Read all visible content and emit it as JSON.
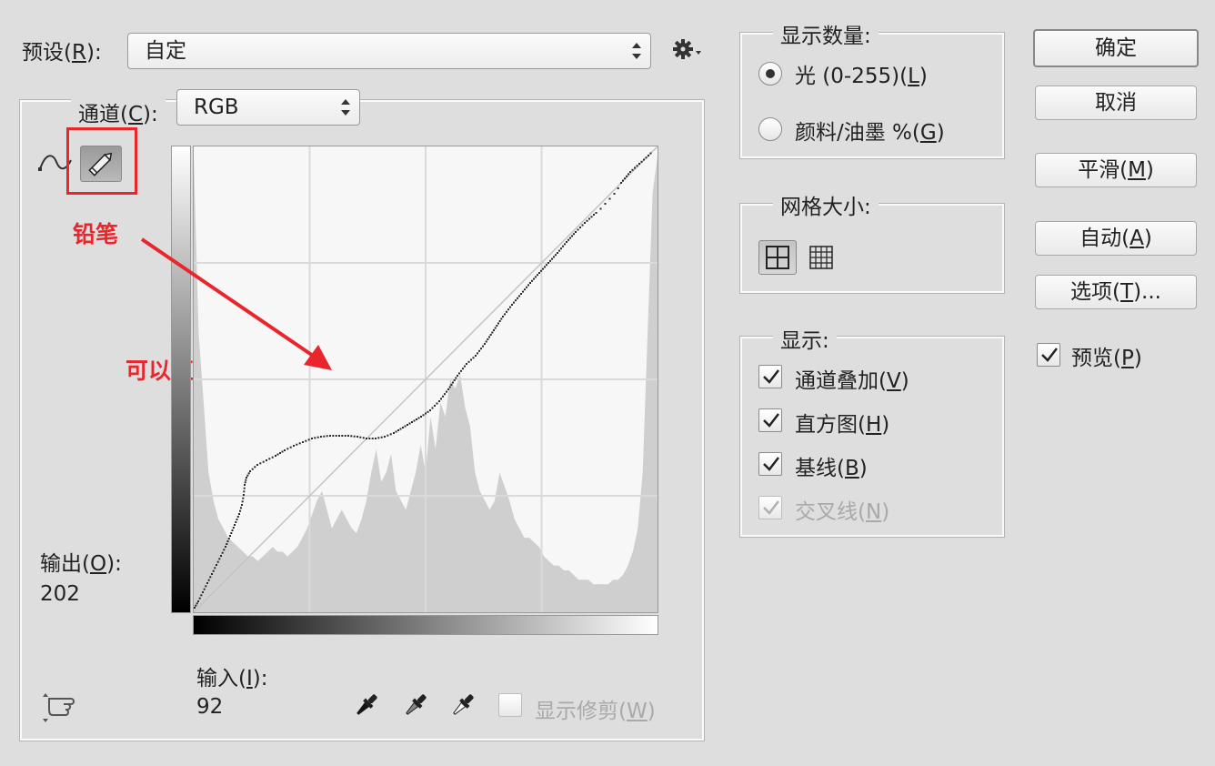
{
  "preset": {
    "label": "预设(",
    "key": "R",
    "suffix": "):",
    "value": "自定"
  },
  "channel": {
    "label": "通道(",
    "key": "C",
    "suffix": "):",
    "value": "RGB"
  },
  "output": {
    "label": "输出(",
    "key": "O",
    "suffix": "):",
    "value": "202"
  },
  "input": {
    "label": "输入(",
    "key": "I",
    "suffix": "):",
    "value": "92"
  },
  "show_clipping": {
    "label": "显示修剪(",
    "key": "W",
    "suffix": ")",
    "checked": false,
    "enabled": false
  },
  "annotations": {
    "pencil": "铅笔",
    "draw_directly": "可以直接画",
    "color": "#e8262b"
  },
  "display_amount": {
    "title": "显示数量:",
    "options": [
      {
        "label": "光 (0-255)(",
        "key": "L",
        "suffix": ")",
        "selected": true
      },
      {
        "label": "颜料/油墨 %(",
        "key": "G",
        "suffix": ")",
        "selected": false
      }
    ]
  },
  "grid_size": {
    "title": "网格大小:",
    "selected": "simple"
  },
  "show": {
    "title": "显示:",
    "options": [
      {
        "label": "通道叠加(",
        "key": "V",
        "suffix": ")",
        "checked": true,
        "enabled": true
      },
      {
        "label": "直方图(",
        "key": "H",
        "suffix": ")",
        "checked": true,
        "enabled": true
      },
      {
        "label": "基线(",
        "key": "B",
        "suffix": ")",
        "checked": true,
        "enabled": true
      },
      {
        "label": "交叉线(",
        "key": "N",
        "suffix": ")",
        "checked": true,
        "enabled": false
      }
    ]
  },
  "buttons": {
    "ok": "确定",
    "cancel": "取消",
    "smooth": {
      "label": "平滑(",
      "key": "M",
      "suffix": ")"
    },
    "auto": {
      "label": "自动(",
      "key": "A",
      "suffix": ")"
    },
    "options": {
      "label": "选项(",
      "key": "T",
      "suffix": ")..."
    }
  },
  "preview": {
    "label": "预览(",
    "key": "P",
    "suffix": ")",
    "checked": true
  },
  "curve": {
    "input_range": [
      0,
      255
    ],
    "output_range": [
      0,
      255
    ],
    "pencil_points": [
      [
        1,
        5
      ],
      [
        5,
        12
      ],
      [
        10,
        22
      ],
      [
        15,
        32
      ],
      [
        20,
        42
      ],
      [
        25,
        52
      ],
      [
        30,
        62
      ],
      [
        35,
        72
      ],
      [
        40,
        84
      ],
      [
        45,
        96
      ],
      [
        50,
        108
      ],
      [
        53,
        118
      ],
      [
        55,
        129
      ],
      [
        56,
        140
      ],
      [
        58,
        148
      ],
      [
        62,
        155
      ],
      [
        70,
        162
      ],
      [
        80,
        167
      ],
      [
        90,
        172
      ],
      [
        100,
        178
      ],
      [
        110,
        183
      ],
      [
        120,
        187
      ],
      [
        130,
        191
      ],
      [
        140,
        193
      ],
      [
        150,
        194
      ],
      [
        160,
        194
      ],
      [
        170,
        194
      ],
      [
        180,
        193
      ],
      [
        190,
        191
      ],
      [
        200,
        191
      ],
      [
        210,
        193
      ],
      [
        220,
        197
      ],
      [
        230,
        203
      ],
      [
        240,
        209
      ],
      [
        250,
        215
      ],
      [
        260,
        222
      ],
      [
        270,
        232
      ],
      [
        280,
        245
      ],
      [
        290,
        260
      ],
      [
        300,
        273
      ],
      [
        310,
        282
      ],
      [
        320,
        295
      ],
      [
        330,
        310
      ],
      [
        340,
        325
      ],
      [
        350,
        338
      ],
      [
        360,
        350
      ],
      [
        370,
        362
      ],
      [
        380,
        373
      ],
      [
        390,
        384
      ],
      [
        400,
        395
      ],
      [
        410,
        407
      ],
      [
        420,
        418
      ],
      [
        430,
        428
      ],
      [
        440,
        437
      ],
      [
        445,
        441
      ],
      [
        450,
        446
      ],
      [
        455,
        452
      ],
      [
        460,
        457
      ],
      [
        465,
        463
      ],
      [
        470,
        472
      ],
      [
        480,
        484
      ],
      [
        490,
        493
      ],
      [
        500,
        502
      ],
      [
        505,
        507
      ]
    ],
    "histogram_levels": [
      0.98,
      0.6,
      0.45,
      0.3,
      0.24,
      0.2,
      0.18,
      0.16,
      0.15,
      0.14,
      0.13,
      0.12,
      0.12,
      0.11,
      0.12,
      0.13,
      0.14,
      0.13,
      0.13,
      0.12,
      0.13,
      0.14,
      0.16,
      0.18,
      0.21,
      0.24,
      0.26,
      0.22,
      0.18,
      0.2,
      0.22,
      0.2,
      0.18,
      0.17,
      0.2,
      0.24,
      0.3,
      0.35,
      0.28,
      0.3,
      0.34,
      0.26,
      0.24,
      0.22,
      0.26,
      0.3,
      0.36,
      0.3,
      0.42,
      0.35,
      0.45,
      0.42,
      0.5,
      0.48,
      0.51,
      0.44,
      0.4,
      0.3,
      0.26,
      0.24,
      0.22,
      0.24,
      0.3,
      0.27,
      0.24,
      0.2,
      0.18,
      0.16,
      0.16,
      0.15,
      0.14,
      0.12,
      0.11,
      0.1,
      0.1,
      0.09,
      0.09,
      0.08,
      0.07,
      0.07,
      0.07,
      0.06,
      0.06,
      0.06,
      0.06,
      0.07,
      0.07,
      0.08,
      0.1,
      0.13,
      0.18,
      0.3,
      0.6,
      0.9,
      0.98
    ],
    "grid": "4x4",
    "show_baseline": true
  }
}
